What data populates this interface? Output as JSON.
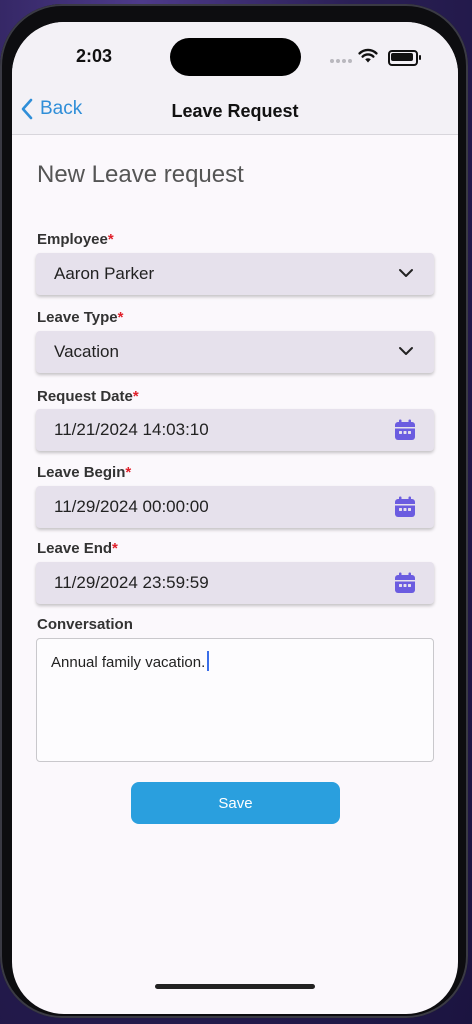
{
  "status_bar": {
    "time": "2:03"
  },
  "nav": {
    "back_label": "Back",
    "title": "Leave Request"
  },
  "form": {
    "title": "New Leave request",
    "employee": {
      "label": "Employee",
      "required_mark": "*",
      "value": "Aaron Parker"
    },
    "leave_type": {
      "label": "Leave Type",
      "required_mark": "*",
      "value": "Vacation"
    },
    "request_date": {
      "label": "Request Date",
      "required_mark": "*",
      "value": "11/21/2024 14:03:10"
    },
    "leave_begin": {
      "label": "Leave Begin",
      "required_mark": "*",
      "value": "11/29/2024 00:00:00"
    },
    "leave_end": {
      "label": "Leave End",
      "required_mark": "*",
      "value": "11/29/2024 23:59:59"
    },
    "conversation": {
      "label": "Conversation",
      "value": "Annual family vacation."
    },
    "save_label": "Save"
  },
  "icons": {
    "back": "chevron-left-icon",
    "dropdown": "chevron-down-icon",
    "date": "calendar-icon"
  },
  "colors": {
    "accent": "#2a9fde",
    "link": "#2f8ed8",
    "required": "#e0202a",
    "calendar_icon": "#6b5ce0",
    "field_bg": "#e6e1ec"
  }
}
